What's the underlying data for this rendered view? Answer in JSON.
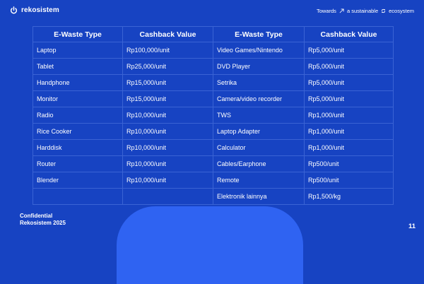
{
  "header": {
    "brand_name": "rekosistem",
    "tagline_part1": "Towards",
    "tagline_part2": "a sustainable",
    "tagline_part3": "ecosystem",
    "icons": [
      "power-logo-icon",
      "arrow-up-right-icon",
      "recycle-icon"
    ]
  },
  "table": {
    "headers": [
      "E-Waste Type",
      "Cashback Value",
      "E-Waste Type",
      "Cashback Value"
    ],
    "rows": [
      [
        "Laptop",
        "Rp100,000/unit",
        "Video Games/Nintendo",
        "Rp5,000/unit"
      ],
      [
        "Tablet",
        "Rp25,000/unit",
        "DVD Player",
        "Rp5,000/unit"
      ],
      [
        "Handphone",
        "Rp15,000/unit",
        "Setrika",
        "Rp5,000/unit"
      ],
      [
        "Monitor",
        "Rp15,000/unit",
        "Camera/video recorder",
        "Rp5,000/unit"
      ],
      [
        "Radio",
        "Rp10,000/unit",
        "TWS",
        "Rp1,000/unit"
      ],
      [
        "Rice Cooker",
        "Rp10,000/unit",
        "Laptop Adapter",
        "Rp1,000/unit"
      ],
      [
        "Harddisk",
        "Rp10,000/unit",
        "Calculator",
        "Rp1,000/unit"
      ],
      [
        "Router",
        "Rp10,000/unit",
        "Cables/Earphone",
        "Rp500/unit"
      ],
      [
        "Blender",
        "Rp10,000/unit",
        "Remote",
        "Rp500/unit"
      ],
      [
        "",
        "",
        "Elektronik lainnya",
        "Rp1,500/kg"
      ]
    ]
  },
  "footer": {
    "line1": "Confidential",
    "line2": "Rekosistem 2025",
    "page_number": "11"
  },
  "colors": {
    "background": "#1743c2",
    "grid_line": "#3a63d4",
    "bottom_shape": "#2f63f2",
    "text": "#ffffff"
  }
}
